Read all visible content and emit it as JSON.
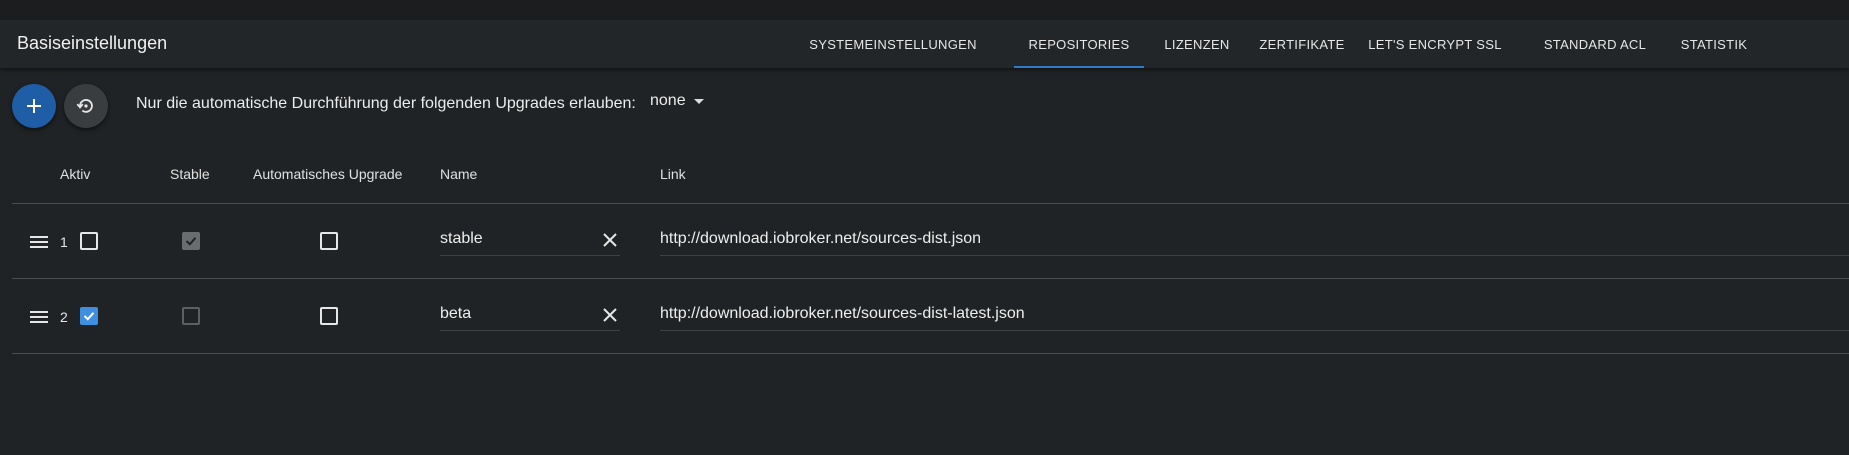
{
  "header": {
    "title": "Basiseinstellungen",
    "tabs": [
      {
        "label": "SYSTEMEINSTELLUNGEN",
        "active": false
      },
      {
        "label": "REPOSITORIES",
        "active": true
      },
      {
        "label": "LIZENZEN",
        "active": false
      },
      {
        "label": "ZERTIFIKATE",
        "active": false
      },
      {
        "label": "LET'S ENCRYPT SSL",
        "active": false
      },
      {
        "label": "STANDARD ACL",
        "active": false
      },
      {
        "label": "STATISTIK",
        "active": false
      }
    ]
  },
  "toolbar": {
    "add_icon": "plus-icon",
    "restore_icon": "restore-icon",
    "upgrade_label": "Nur die automatische Durchführung der folgenden Upgrades erlauben:",
    "upgrade_value": "none"
  },
  "table": {
    "columns": {
      "active": "Aktiv",
      "stable": "Stable",
      "auto_upgrade": "Automatisches Upgrade",
      "name": "Name",
      "link": "Link"
    },
    "rows": [
      {
        "num": "1",
        "active": false,
        "stable": true,
        "auto_upgrade": false,
        "name": "stable",
        "link": "http://download.iobroker.net/sources-dist.json"
      },
      {
        "num": "2",
        "active": true,
        "stable": false,
        "auto_upgrade": false,
        "name": "beta",
        "link": "http://download.iobroker.net/sources-dist-latest.json"
      }
    ]
  },
  "colors": {
    "background": "#202325",
    "header": "#232628",
    "accent": "#1f5ea6",
    "checkbox_checked": "#3f8fe0",
    "tab_indicator": "#2f79c9"
  }
}
